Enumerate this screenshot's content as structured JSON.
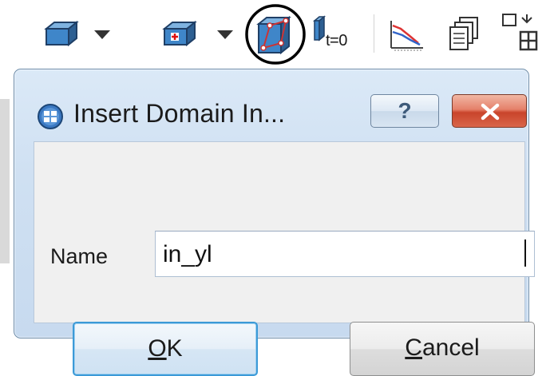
{
  "toolbar": {
    "tools": [
      {
        "icon": "block-dropdown-icon"
      },
      {
        "icon": "block-add-dropdown-icon"
      },
      {
        "icon": "insert-domain-interface-icon",
        "highlighted": true
      },
      {
        "icon": "initial-condition-icon",
        "label": "t=0"
      },
      {
        "icon": "plot-icon"
      },
      {
        "icon": "copy-pages-icon"
      },
      {
        "icon": "grid-layout-icon"
      }
    ]
  },
  "dialog": {
    "title": "Insert Domain In...",
    "help_label": "?",
    "name_label": "Name",
    "name_value": "in_yl",
    "ok_label_mnemonic": "O",
    "ok_label_rest": "K",
    "cancel_label_mnemonic": "C",
    "cancel_label_rest": "ancel"
  },
  "colors": {
    "dialog_frame": "#c7daef",
    "close_button": "#c9442b",
    "ok_focus_border": "#3c9ad7",
    "highlight_circle": "#000000"
  }
}
